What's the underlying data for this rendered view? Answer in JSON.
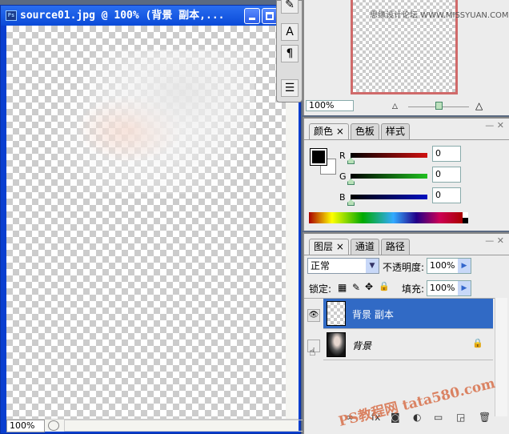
{
  "document": {
    "title": "source01.jpg @ 100% (背景 副本,...",
    "zoom": "100%",
    "app_icon": "Ps"
  },
  "navigator": {
    "zoom": "100%",
    "watermark": "思缘设计论坛  WWW.MISSYUAN.COM"
  },
  "color_panel": {
    "tabs": [
      "颜色",
      "色板",
      "样式"
    ],
    "channels": [
      {
        "label": "R",
        "value": "0",
        "color": "#d01010"
      },
      {
        "label": "G",
        "value": "0",
        "color": "#20c020"
      },
      {
        "label": "B",
        "value": "0",
        "color": "#0010c0"
      }
    ],
    "foreground": "#000000",
    "background": "#ffffff"
  },
  "layers_panel": {
    "tabs": [
      "图层",
      "通道",
      "路径"
    ],
    "blend_mode": "正常",
    "opacity_label": "不透明度:",
    "opacity": "100%",
    "lock_label": "锁定:",
    "fill_label": "填充:",
    "fill": "100%",
    "layers": [
      {
        "name": "背景 副本",
        "visible": true,
        "selected": true
      },
      {
        "name": "背景",
        "visible": false,
        "locked": true
      }
    ]
  },
  "watermark": "PS教程网 tata580.com",
  "accent": "#316ac5"
}
